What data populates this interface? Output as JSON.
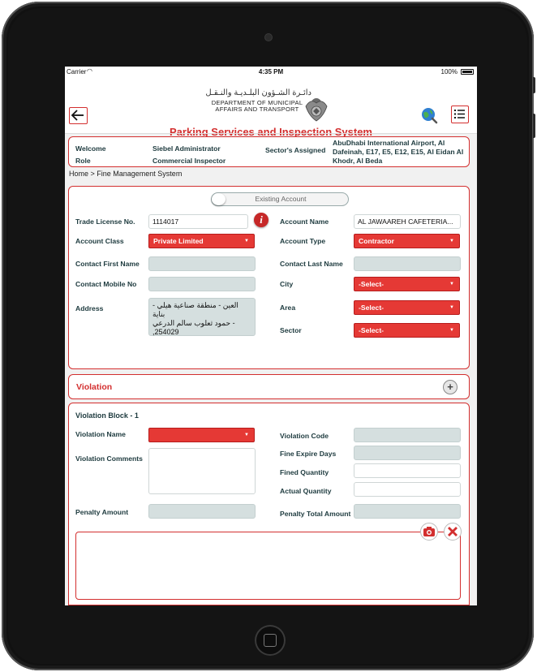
{
  "status_bar": {
    "carrier": "Carrier",
    "time": "4:35 PM",
    "battery": "100%"
  },
  "header": {
    "org_name_ar": "دائـرة الشـؤون البلـديـة والنـقـل",
    "org_name_en_line1": "DEPARTMENT OF MUNICIPAL",
    "org_name_en_line2": "AFFAIRS AND TRANSPORT",
    "app_title": "Parking Services and Inspection System",
    "icons": {
      "back": "back-arrow-icon",
      "globe": "globe-search-icon",
      "menu": "list-menu-icon",
      "emblem": "falcon-emblem-icon"
    }
  },
  "user_info": {
    "welcome_label": "Welcome",
    "welcome_value": "Siebel Administrator",
    "role_label": "Role",
    "role_value": "Commercial Inspector",
    "sectors_label": "Sector's Assigned",
    "sectors_value": "AbuDhabi International Airport, Al Dafeinah, E17, E5, E12, E15, Al Eidan Al Khodr, Al Beda"
  },
  "breadcrumb": "Home >  Fine Management System",
  "account": {
    "toggle_label": "Existing Account",
    "trade_license_label": "Trade License No.",
    "trade_license_value": "1114017",
    "account_name_label": "Account Name",
    "account_name_value": "AL JAWAAREH CAFETERIA...",
    "account_class_label": "Account Class",
    "account_class_value": "Private Limited",
    "account_type_label": "Account Type",
    "account_type_value": "Contractor",
    "first_name_label": "Contact First Name",
    "last_name_label": "Contact Last Name",
    "mobile_label": "Contact Mobile No",
    "city_label": "City",
    "city_value": "-Select-",
    "address_label": "Address",
    "address_line1": "العين - منطقة صناعية هيلي - بناية",
    "address_line2": "- حمود ثعلوب سالم الدرعي",
    "address_line3": ",254029",
    "area_label": "Area",
    "area_value": "-Select-",
    "sector_label": "Sector",
    "sector_value": "-Select-"
  },
  "violation_section": {
    "title": "Violation"
  },
  "violation_block": {
    "title": "Violation Block -  1",
    "violation_name_label": "Violation Name",
    "violation_comments_label": "Violation Comments",
    "penalty_amount_label": "Penalty Amount",
    "violation_code_label": "Violation Code",
    "fine_expire_days_label": "Fine Expire Days",
    "fined_quantity_label": "Fined Quantity",
    "actual_quantity_label": "Actual Quantity",
    "penalty_total_label": "Penalty Total Amount"
  },
  "colors": {
    "accent": "#d32f2f",
    "select_bg": "#e53935",
    "readonly_bg": "#d5dfdf",
    "label": "#1d3a3e"
  }
}
